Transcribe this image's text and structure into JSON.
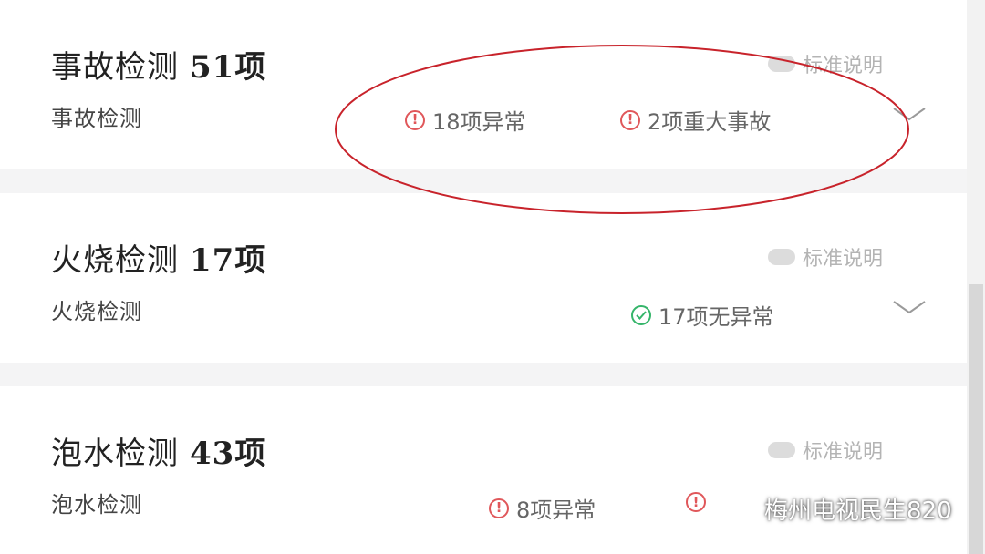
{
  "sections": [
    {
      "title": "事故检测",
      "count": "51项",
      "subtitle": "事故检测",
      "std_label": "标准说明",
      "statuses": [
        {
          "icon": "warning-icon",
          "text": "18项异常"
        },
        {
          "icon": "warning-icon",
          "text": "2项重大事故"
        }
      ]
    },
    {
      "title": "火烧检测",
      "count": "17项",
      "subtitle": "火烧检测",
      "std_label": "标准说明",
      "statuses": [
        {
          "icon": "check-icon",
          "text": "17项无异常"
        }
      ]
    },
    {
      "title": "泡水检测",
      "count": "43项",
      "subtitle": "泡水检测",
      "std_label": "标准说明",
      "statuses": [
        {
          "icon": "warning-icon",
          "text": "8项异常"
        }
      ]
    }
  ],
  "watermark": "梅州电视民生820",
  "colors": {
    "warning": "#e0575a",
    "ok": "#35b56a",
    "annotation": "#c8232b"
  }
}
